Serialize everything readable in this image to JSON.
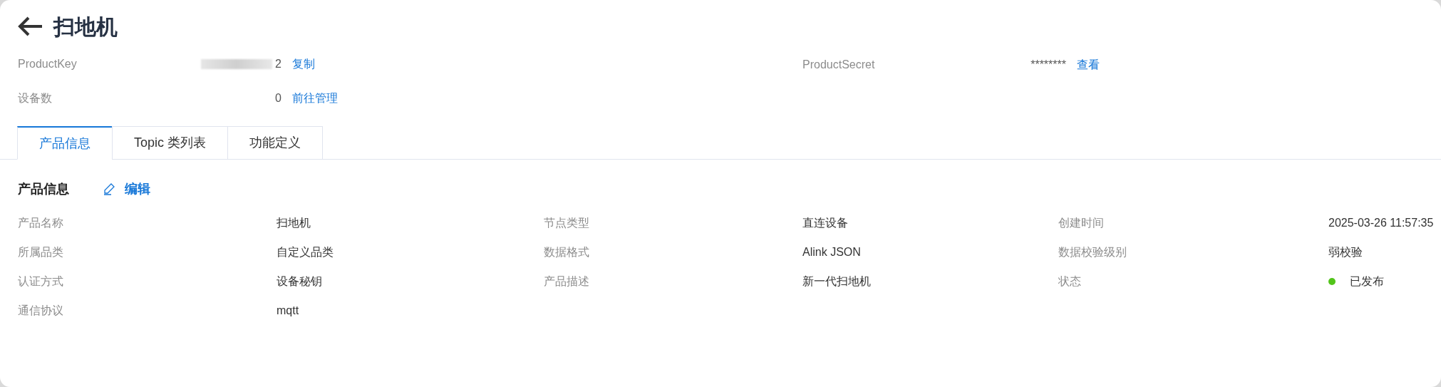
{
  "title": "扫地机",
  "header_fields": [
    {
      "label": "ProductKey",
      "value": "2",
      "redacted": true,
      "link": "复制"
    },
    {
      "label": "ProductSecret",
      "value": "********",
      "redacted": false,
      "link": "查看"
    },
    {
      "label": "设备数",
      "value": "0",
      "redacted": false,
      "link": "前往管理"
    }
  ],
  "tabs": [
    {
      "label": "产品信息",
      "selected": true
    },
    {
      "label": "Topic 类列表",
      "selected": false
    },
    {
      "label": "功能定义",
      "selected": false
    }
  ],
  "section": {
    "title": "产品信息",
    "edit": "编辑"
  },
  "info_rows": [
    [
      {
        "label": "产品名称",
        "value": "扫地机"
      },
      {
        "label": "节点类型",
        "value": "直连设备"
      },
      {
        "label": "创建时间",
        "value": "2025-03-26 11:57:35"
      }
    ],
    [
      {
        "label": "所属品类",
        "value": "自定义品类"
      },
      {
        "label": "数据格式",
        "value": "Alink JSON"
      },
      {
        "label": "数据校验级别",
        "value": "弱校验"
      }
    ],
    [
      {
        "label": "认证方式",
        "value": "设备秘钥"
      },
      {
        "label": "产品描述",
        "value": "新一代扫地机"
      },
      {
        "label": "状态",
        "value": "已发布",
        "color": "#52c41a"
      }
    ],
    [
      {
        "label": "通信协议",
        "value": "mqtt"
      }
    ]
  ]
}
